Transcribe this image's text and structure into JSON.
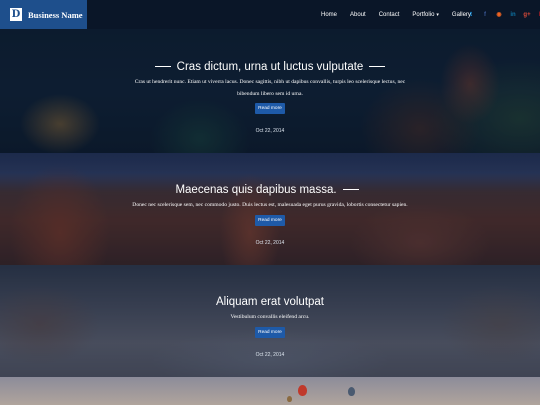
{
  "header": {
    "logo_letter": "D",
    "brand_name": "Business Name",
    "nav": [
      {
        "label": "Home"
      },
      {
        "label": "About"
      },
      {
        "label": "Contact"
      },
      {
        "label": "Portfolio",
        "has_dropdown": true
      },
      {
        "label": "Gallery"
      }
    ],
    "social": [
      {
        "icon": "twitter-icon",
        "glyph": "t",
        "color": "#1da1f2"
      },
      {
        "icon": "facebook-icon",
        "glyph": "f",
        "color": "#3b5998"
      },
      {
        "icon": "rss-icon",
        "glyph": "◉",
        "color": "#f26522"
      },
      {
        "icon": "linkedin-icon",
        "glyph": "in",
        "color": "#0e76a8"
      },
      {
        "icon": "google-plus-icon",
        "glyph": "g+",
        "color": "#dd4b39"
      },
      {
        "icon": "pinterest-icon",
        "glyph": "P",
        "color": "#cb2027"
      }
    ]
  },
  "posts": [
    {
      "title": "Cras dictum, urna ut luctus vulputate",
      "excerpt_line1": "Cras ut hendrerit nunc. Etiam ut viverra lacus. Donec sagittis, nibh ut dapibus convallis, turpis leo scelerisque lectus, nec",
      "excerpt_line2": "bibendum libero sem id urna.",
      "button": "Read more",
      "date": "Oct 22, 2014"
    },
    {
      "title": "Maecenas quis dapibus massa.",
      "excerpt_line1": "Donec nec scelerisque sem, nec commodo justo. Duis lectus est, malesuada eget purus gravida, lobortis consectetur sapien.",
      "button": "Read more",
      "date": "Oct 22, 2014"
    },
    {
      "title": "Aliquam erat volutpat",
      "excerpt_line1": "Vestibulum convallis eleifend arcu.",
      "button": "Read more",
      "date": "Oct 22, 2014"
    }
  ],
  "colors": {
    "brand_bg": "#1e4f8c",
    "header_bg": "#0a1628",
    "button_bg": "#1e5aa8"
  }
}
